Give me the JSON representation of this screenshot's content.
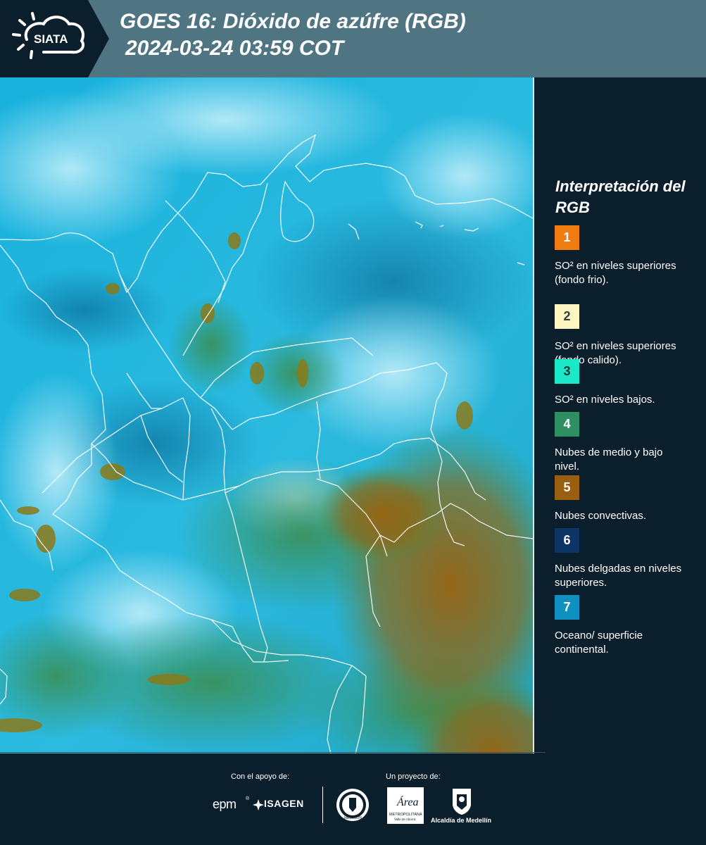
{
  "header": {
    "logo_text": "SIATA",
    "title_line1": "GOES 16: Dióxido de azúfre (RGB)",
    "title_line2": "2024-03-24 03:59 COT"
  },
  "legend": {
    "title": "Interpretación del RGB",
    "items": [
      {
        "number": "1",
        "color": "#f07c0f",
        "text_color": "#ffffff",
        "label": "SO² en niveles superiores (fondo frio)."
      },
      {
        "number": "2",
        "color": "#fdf5c2",
        "text_color": "#3a3a3a",
        "label": "SO² en niveles superiores (fondo calido)."
      },
      {
        "number": "3",
        "color": "#1ae8c8",
        "text_color": "#0b3b33",
        "label": "SO² en niveles bajos."
      },
      {
        "number": "4",
        "color": "#2e8f63",
        "text_color": "#ffffff",
        "label": "Nubes de medio y bajo nivel."
      },
      {
        "number": "5",
        "color": "#9a5e10",
        "text_color": "#ffffff",
        "label": "Nubes convectivas."
      },
      {
        "number": "6",
        "color": "#0c3566",
        "text_color": "#ffffff",
        "label": "Nubes delgadas en niveles superiores."
      },
      {
        "number": "7",
        "color": "#1090c0",
        "text_color": "#ffffff",
        "label": "Oceano/ superficie continental."
      }
    ]
  },
  "footer": {
    "support_label": "Con el apoyo de:",
    "project_label": "Un proyecto de:",
    "sponsor_epm": "epm",
    "sponsor_isagen": "ISAGEN",
    "logo_area_name": "Área",
    "logo_area_sub": "METROPOLITANA",
    "logo_area_sub2": "Valle de Aburrá",
    "logo_alcaldia": "Alcaldía de Medellín",
    "logo_medellin_seal": "MEDELLÍN"
  },
  "colors": {
    "ocean_cyan": "#22b7e0",
    "cloud_light": "#7fd9ef",
    "low_cloud_green": "#2e8f63",
    "convective_brown": "#9a5e10",
    "header_bg": "#4f7583",
    "panel_bg": "#0b1e2b"
  }
}
